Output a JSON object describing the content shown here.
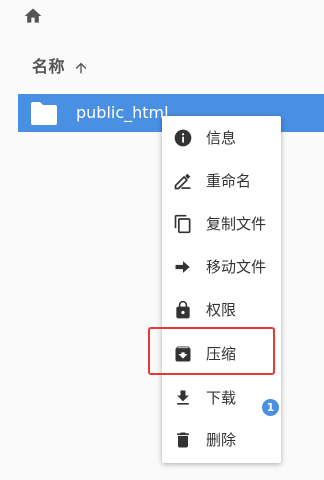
{
  "topbar": {
    "home_icon": "home-icon"
  },
  "header": {
    "name_label": "名称",
    "sort_icon": "arrow-up-icon"
  },
  "file_list": {
    "selected_item": {
      "name": "public_html",
      "icon": "folder-icon"
    }
  },
  "context_menu": {
    "items": [
      {
        "label": "信息",
        "icon": "info-icon"
      },
      {
        "label": "重命名",
        "icon": "rename-pencil-icon"
      },
      {
        "label": "复制文件",
        "icon": "copy-icon"
      },
      {
        "label": "移动文件",
        "icon": "arrow-right-icon"
      },
      {
        "label": "权限",
        "icon": "lock-icon"
      },
      {
        "label": "压缩",
        "icon": "archive-icon"
      },
      {
        "label": "下载",
        "icon": "download-icon"
      },
      {
        "label": "删除",
        "icon": "trash-icon"
      }
    ]
  },
  "badge": {
    "count": "1"
  },
  "colors": {
    "selection": "#4a90e2",
    "highlight_border": "#e53935",
    "icon": "#333333",
    "badge": "#4a90e2"
  }
}
